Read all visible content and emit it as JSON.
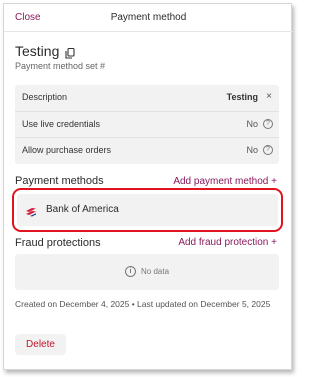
{
  "header": {
    "close_label": "Close",
    "title": "Payment method"
  },
  "payment_method": {
    "name": "Testing",
    "subtitle": "Payment method set #"
  },
  "details": [
    {
      "label": "Description",
      "value": "Testing"
    },
    {
      "label": "Use live credentials",
      "value": "No"
    },
    {
      "label": "Allow purchase orders",
      "value": "No"
    }
  ],
  "payment_methods": {
    "title": "Payment methods",
    "add_label": "Add payment method +",
    "items": [
      {
        "name": "Bank of America"
      }
    ]
  },
  "fraud_protections": {
    "title": "Fraud protections",
    "add_label": "Add fraud protection +",
    "empty_text": "No data"
  },
  "meta": {
    "timestamps": "Created on December 4, 2025 • Last updated on December 5, 2025"
  },
  "actions": {
    "delete_label": "Delete"
  },
  "colors": {
    "accent": "#8a1a5c",
    "highlight": "#e0141e",
    "panel": "#f2f2f2"
  },
  "icons": {
    "copy": "copy-icon",
    "clear": "close-icon",
    "help": "question-circle-icon",
    "info": "info-circle-icon",
    "bank": "bank-of-america-logo"
  }
}
